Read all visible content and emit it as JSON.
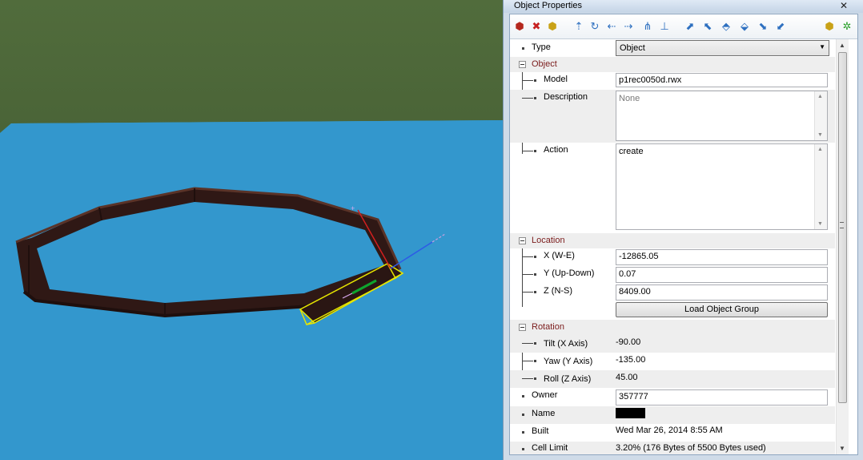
{
  "window": {
    "title": "Object Properties",
    "close_glyph": "✕"
  },
  "toolbar": {
    "icons": [
      "build-icon",
      "delete-icon",
      "select-icon",
      "move-north-icon",
      "rotate-icon",
      "move-left-icon",
      "move-right-icon",
      "tilt-icon",
      "lower-icon",
      "snap-icon",
      "align-icon",
      "copy-icon",
      "group-icon",
      "paste-icon",
      "undo-icon",
      "info-icon",
      "settings-icon"
    ]
  },
  "props": {
    "type": {
      "label": "Type",
      "value": "Object"
    },
    "object": {
      "label": "Object",
      "model": {
        "label": "Model",
        "value": "p1rec0050d.rwx"
      },
      "description": {
        "label": "Description",
        "placeholder": "None"
      },
      "action": {
        "label": "Action",
        "value": "create"
      }
    },
    "location": {
      "label": "Location",
      "x": {
        "label": "X (W-E)",
        "value": "-12865.05"
      },
      "y": {
        "label": "Y (Up-Down)",
        "value": "0.07"
      },
      "z": {
        "label": "Z (N-S)",
        "value": "8409.00"
      },
      "load_group": "Load Object Group"
    },
    "rotation": {
      "label": "Rotation",
      "tilt": {
        "label": "Tilt (X Axis)",
        "value": "-90.00"
      },
      "yaw": {
        "label": "Yaw (Y Axis)",
        "value": "-135.00"
      },
      "roll": {
        "label": "Roll (Z Axis)",
        "value": "45.00"
      }
    },
    "owner": {
      "label": "Owner",
      "value": "357777"
    },
    "name": {
      "label": "Name"
    },
    "built": {
      "label": "Built",
      "value": "Wed Mar 26, 2014 8:55 AM"
    },
    "cell_limit": {
      "label": "Cell Limit",
      "value": "3.20%   (176 Bytes of 5500 Bytes used)"
    }
  },
  "colors": {
    "sky": "#4f6a3b",
    "water": "#3397cd",
    "fence": "#3a1e1a",
    "selection": "#e6e600",
    "category_text": "#7b1c1c"
  }
}
